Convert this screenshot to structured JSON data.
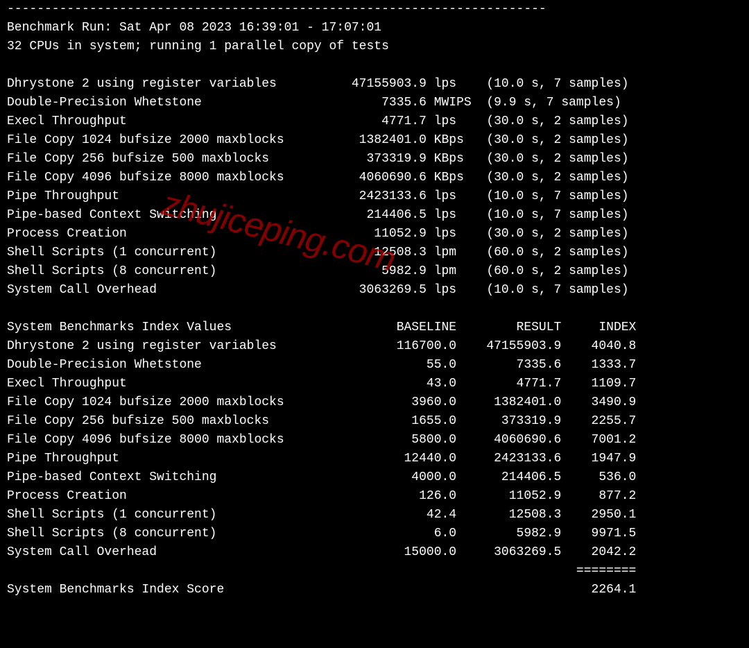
{
  "dashes": "------------------------------------------------------------------------",
  "header": {
    "run_line": "Benchmark Run: Sat Apr 08 2023 16:39:01 - 17:07:01",
    "cpu_line": "32 CPUs in system; running 1 parallel copy of tests"
  },
  "results": [
    {
      "name": "Dhrystone 2 using register variables",
      "value": "47155903.9",
      "unit": "lps",
      "timing": "(10.0 s, 7 samples)"
    },
    {
      "name": "Double-Precision Whetstone",
      "value": "7335.6",
      "unit": "MWIPS",
      "timing": "(9.9 s, 7 samples)"
    },
    {
      "name": "Execl Throughput",
      "value": "4771.7",
      "unit": "lps",
      "timing": "(30.0 s, 2 samples)"
    },
    {
      "name": "File Copy 1024 bufsize 2000 maxblocks",
      "value": "1382401.0",
      "unit": "KBps",
      "timing": "(30.0 s, 2 samples)"
    },
    {
      "name": "File Copy 256 bufsize 500 maxblocks",
      "value": "373319.9",
      "unit": "KBps",
      "timing": "(30.0 s, 2 samples)"
    },
    {
      "name": "File Copy 4096 bufsize 8000 maxblocks",
      "value": "4060690.6",
      "unit": "KBps",
      "timing": "(30.0 s, 2 samples)"
    },
    {
      "name": "Pipe Throughput",
      "value": "2423133.6",
      "unit": "lps",
      "timing": "(10.0 s, 7 samples)"
    },
    {
      "name": "Pipe-based Context Switching",
      "value": "214406.5",
      "unit": "lps",
      "timing": "(10.0 s, 7 samples)"
    },
    {
      "name": "Process Creation",
      "value": "11052.9",
      "unit": "lps",
      "timing": "(30.0 s, 2 samples)"
    },
    {
      "name": "Shell Scripts (1 concurrent)",
      "value": "12508.3",
      "unit": "lpm",
      "timing": "(60.0 s, 2 samples)"
    },
    {
      "name": "Shell Scripts (8 concurrent)",
      "value": "5982.9",
      "unit": "lpm",
      "timing": "(60.0 s, 2 samples)"
    },
    {
      "name": "System Call Overhead",
      "value": "3063269.5",
      "unit": "lps",
      "timing": "(10.0 s, 7 samples)"
    }
  ],
  "index_header": {
    "title": "System Benchmarks Index Values",
    "col_baseline": "BASELINE",
    "col_result": "RESULT",
    "col_index": "INDEX"
  },
  "index_rows": [
    {
      "name": "Dhrystone 2 using register variables",
      "baseline": "116700.0",
      "result": "47155903.9",
      "index": "4040.8"
    },
    {
      "name": "Double-Precision Whetstone",
      "baseline": "55.0",
      "result": "7335.6",
      "index": "1333.7"
    },
    {
      "name": "Execl Throughput",
      "baseline": "43.0",
      "result": "4771.7",
      "index": "1109.7"
    },
    {
      "name": "File Copy 1024 bufsize 2000 maxblocks",
      "baseline": "3960.0",
      "result": "1382401.0",
      "index": "3490.9"
    },
    {
      "name": "File Copy 256 bufsize 500 maxblocks",
      "baseline": "1655.0",
      "result": "373319.9",
      "index": "2255.7"
    },
    {
      "name": "File Copy 4096 bufsize 8000 maxblocks",
      "baseline": "5800.0",
      "result": "4060690.6",
      "index": "7001.2"
    },
    {
      "name": "Pipe Throughput",
      "baseline": "12440.0",
      "result": "2423133.6",
      "index": "1947.9"
    },
    {
      "name": "Pipe-based Context Switching",
      "baseline": "4000.0",
      "result": "214406.5",
      "index": "536.0"
    },
    {
      "name": "Process Creation",
      "baseline": "126.0",
      "result": "11052.9",
      "index": "877.2"
    },
    {
      "name": "Shell Scripts (1 concurrent)",
      "baseline": "42.4",
      "result": "12508.3",
      "index": "2950.1"
    },
    {
      "name": "Shell Scripts (8 concurrent)",
      "baseline": "6.0",
      "result": "5982.9",
      "index": "9971.5"
    },
    {
      "name": "System Call Overhead",
      "baseline": "15000.0",
      "result": "3063269.5",
      "index": "2042.2"
    }
  ],
  "score": {
    "divider": "========",
    "label": "System Benchmarks Index Score",
    "value": "2264.1"
  },
  "watermark": "zhujiceping.com"
}
